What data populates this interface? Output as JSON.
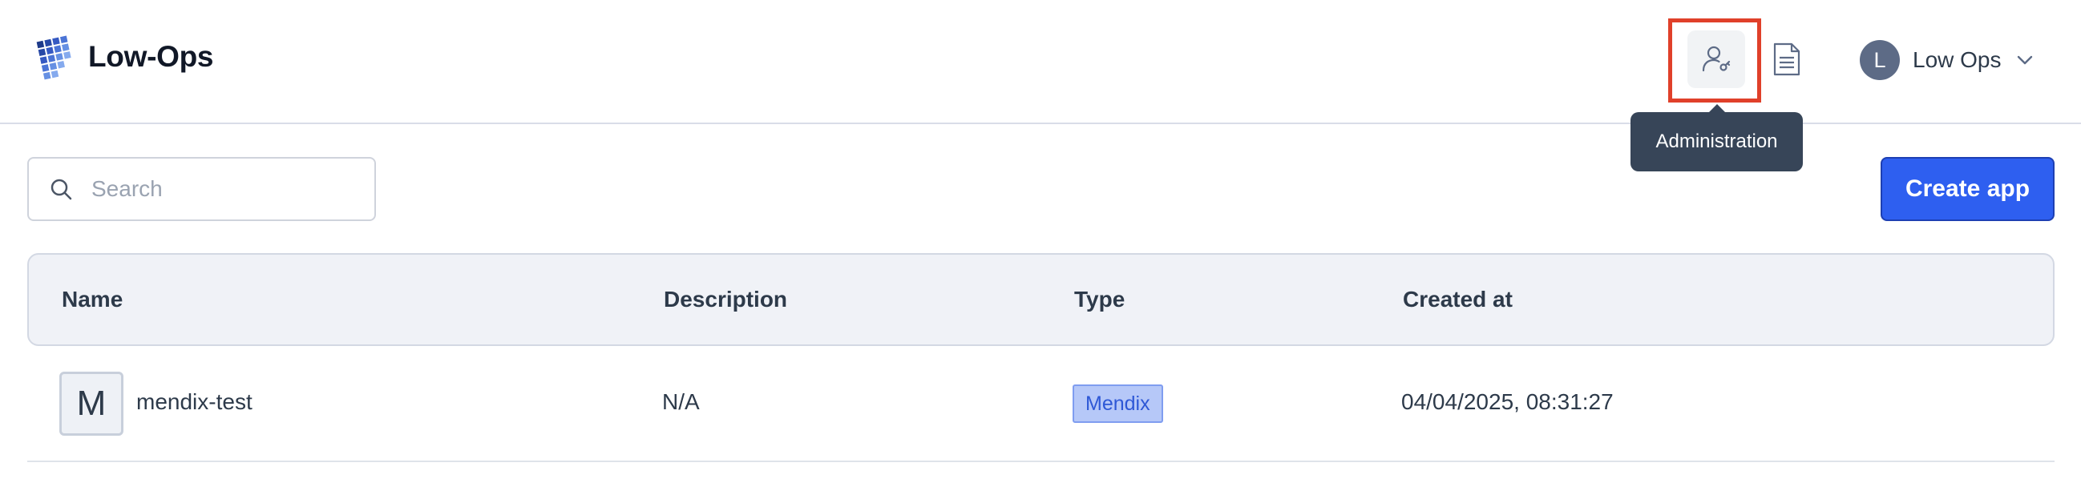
{
  "header": {
    "brand": "Low-Ops",
    "admin_tooltip": "Administration",
    "user": {
      "initial": "L",
      "name": "Low Ops"
    }
  },
  "toolbar": {
    "search_placeholder": "Search",
    "create_label": "Create app"
  },
  "table": {
    "columns": [
      "Name",
      "Description",
      "Type",
      "Created at"
    ],
    "rows": [
      {
        "icon_letter": "M",
        "name": "mendix-test",
        "description": "N/A",
        "type": "Mendix",
        "created_at": "04/04/2025, 08:31:27"
      }
    ]
  },
  "colors": {
    "primary": "#2e5ff0",
    "highlight": "#e0402a",
    "tooltip_bg": "#374558",
    "badge_bg": "#b6c8f8"
  }
}
